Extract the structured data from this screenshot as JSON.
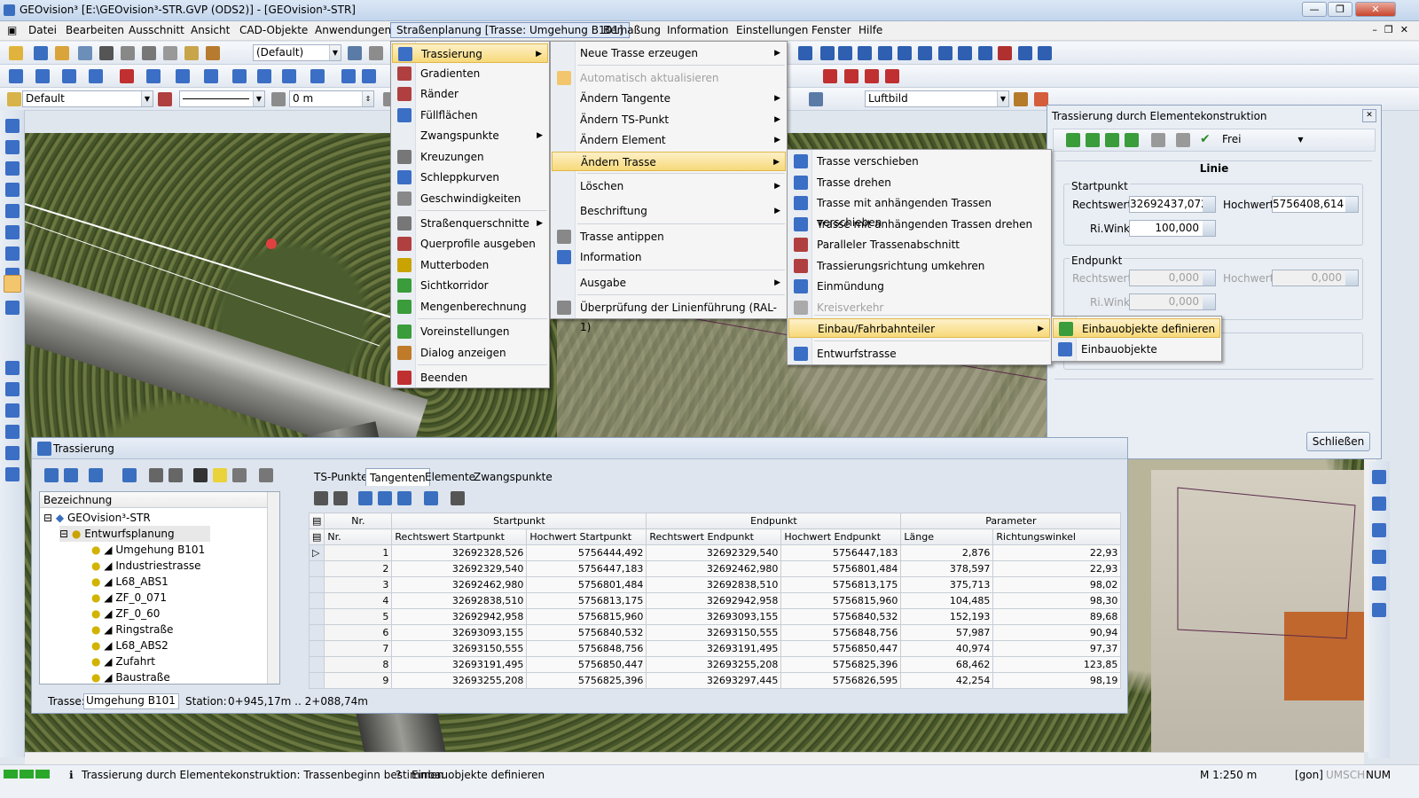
{
  "window": {
    "title": "GEOvision³  [E:\\GEOvision³-STR.GVP (ODS2)] - [GEOvision³-STR]"
  },
  "menubar": [
    "Datei",
    "Bearbeiten",
    "Ausschnitt",
    "Ansicht",
    "CAD-Objekte",
    "Anwendungen",
    "Straßenplanung [Trasse: Umgehung B101]",
    "Bemaßung",
    "Information",
    "Einstellungen",
    "Fenster",
    "Hilfe"
  ],
  "toolbar": {
    "layer_combo": "(Default)",
    "style_combo": "Default",
    "offset_value": "0 m",
    "background_combo": "Luftbild"
  },
  "menu1": [
    "Trassierung",
    "Gradienten",
    "Ränder",
    "Füllflächen",
    "Zwangspunkte",
    "Kreuzungen",
    "Schleppkurven",
    "Geschwindigkeiten",
    "Straßenquerschnitte",
    "Querprofile ausgeben",
    "Mutterboden",
    "Sichtkorridor",
    "Mengenberechnung",
    "Voreinstellungen",
    "Dialog anzeigen",
    "Beenden"
  ],
  "menu2": [
    "Neue Trasse erzeugen",
    "Automatisch aktualisieren",
    "Ändern Tangente",
    "Ändern TS-Punkt",
    "Ändern Element",
    "Ändern Trasse",
    "Löschen",
    "Beschriftung",
    "Trasse antippen",
    "Information",
    "Ausgabe",
    "Überprüfung der Linienführung (RAL-1)"
  ],
  "menu3": [
    "Trasse verschieben",
    "Trasse drehen",
    "Trasse mit anhängenden Trassen verschieben",
    "Trasse mit anhängenden Trassen drehen",
    "Paralleler Trassenabschnitt",
    "Trassierungsrichtung umkehren",
    "Einmündung",
    "Kreisverkehr",
    "Einbau/Fahrbahnteiler",
    "Entwurfstrasse"
  ],
  "menu4": [
    "Einbauobjekte definieren",
    "Einbauobjekte"
  ],
  "dialog": {
    "title": "Trassierung durch Elementekonstruktion",
    "mode": "Frei",
    "section": "Linie",
    "start_group": "Startpunkt",
    "end_group": "Endpunkt",
    "rechtswert_label": "Rechtswert:",
    "hochwert_label": "Hochwert:",
    "riwinkel_label": "Ri.Winkel:",
    "start_rechtswert": "32692437,072",
    "start_hochwert": "5756408,614",
    "start_riwinkel": "100,000",
    "end_rechtswert": "0,000",
    "end_hochwert": "0,000",
    "end_riwinkel": "0,000",
    "close_label": "Schließen"
  },
  "panel": {
    "title": "Trassierung",
    "tree_header": "Bezeichnung",
    "tree": [
      "GEOvision³-STR",
      "Entwurfsplanung",
      "Umgehung B101",
      "Industriestrasse",
      "L68_ABS1",
      "ZF_0_071",
      "ZF_0_60",
      "Ringstraße",
      "L68_ABS2",
      "Zufahrt",
      "Baustraße"
    ],
    "tabs": [
      "TS-Punkte",
      "Tangenten",
      "Elemente",
      "Zwangspunkte"
    ],
    "trasse_label": "Trasse:",
    "trasse_value": "Umgehung B101",
    "station_label": "Station:",
    "station_value": "0+945,17m .. 2+088,74m",
    "group_headers": [
      "Nr.",
      "Startpunkt",
      "Endpunkt",
      "Parameter"
    ],
    "columns": [
      "Nr.",
      "Rechtswert Startpunkt",
      "Hochwert Startpunkt",
      "Rechtswert Endpunkt",
      "Hochwert Endpunkt",
      "Länge",
      "Richtungswinkel"
    ],
    "rows": [
      [
        "1",
        "32692328,526",
        "5756444,492",
        "32692329,540",
        "5756447,183",
        "2,876",
        "22,93"
      ],
      [
        "2",
        "32692329,540",
        "5756447,183",
        "32692462,980",
        "5756801,484",
        "378,597",
        "22,93"
      ],
      [
        "3",
        "32692462,980",
        "5756801,484",
        "32692838,510",
        "5756813,175",
        "375,713",
        "98,02"
      ],
      [
        "4",
        "32692838,510",
        "5756813,175",
        "32692942,958",
        "5756815,960",
        "104,485",
        "98,30"
      ],
      [
        "5",
        "32692942,958",
        "5756815,960",
        "32693093,155",
        "5756840,532",
        "152,193",
        "89,68"
      ],
      [
        "6",
        "32693093,155",
        "5756840,532",
        "32693150,555",
        "5756848,756",
        "57,987",
        "90,94"
      ],
      [
        "7",
        "32693150,555",
        "5756848,756",
        "32693191,495",
        "5756850,447",
        "40,974",
        "97,37"
      ],
      [
        "8",
        "32693191,495",
        "5756850,447",
        "32693255,208",
        "5756825,396",
        "68,462",
        "123,85"
      ],
      [
        "9",
        "32693255,208",
        "5756825,396",
        "32693297,445",
        "5756826,595",
        "42,254",
        "98,19"
      ]
    ]
  },
  "status": {
    "left": "Trassierung durch Elementekonstruktion: Trassenbeginn bestimmen",
    "hint": "Einbauobjekte definieren",
    "scale": "M 1:250  m",
    "angle_unit": "[gon]",
    "umsch": "UMSCH",
    "num": "NUM"
  },
  "colors": {
    "menu_highlight": "#f7d979",
    "accent": "#3a6fc0"
  }
}
